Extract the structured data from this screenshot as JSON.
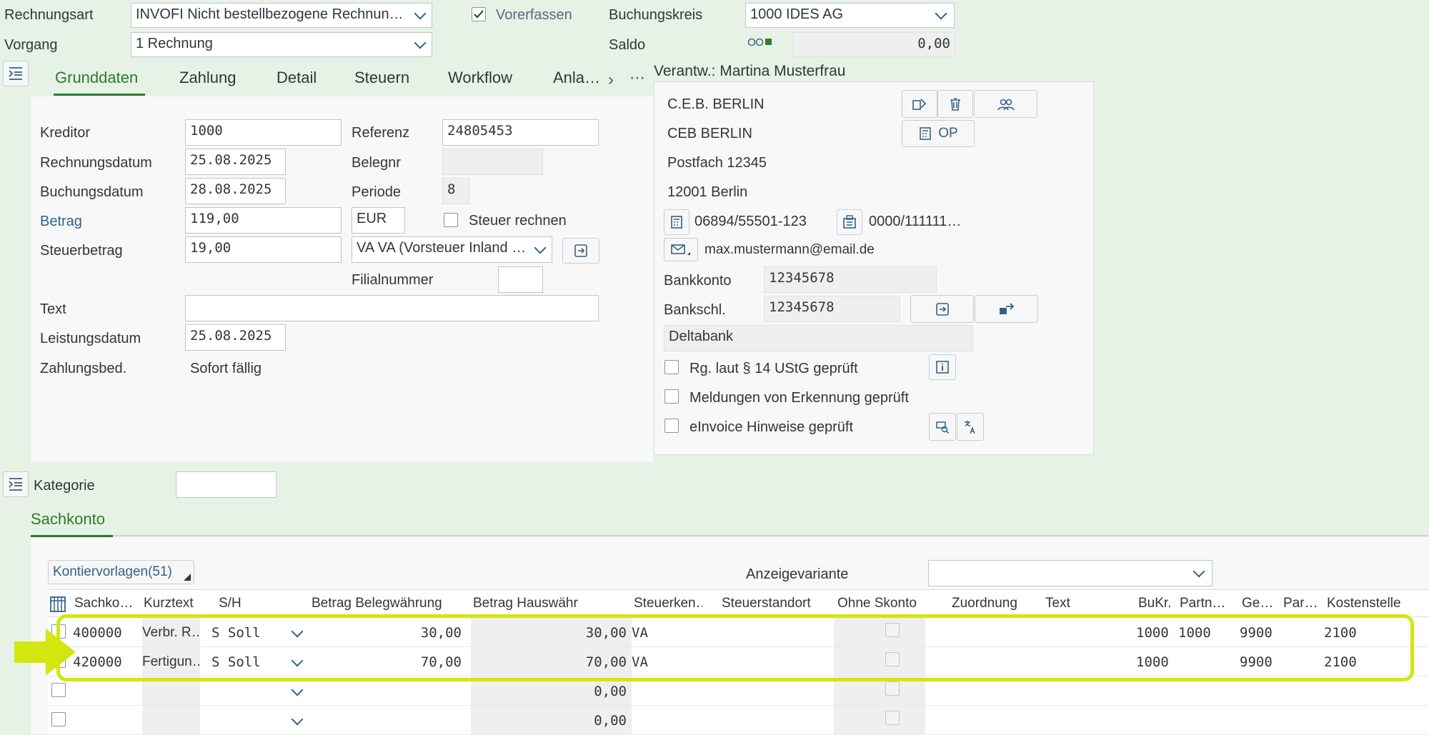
{
  "header": {
    "rechnungsart_label": "Rechnungsart",
    "rechnungsart_value": "INVOFI Nicht bestellbezogene Rechnun…",
    "vorgang_label": "Vorgang",
    "vorgang_value": "1 Rechnung",
    "vorerfassen_label": "Vorerfassen",
    "vorerfassen_checked": true,
    "buchungskreis_label": "Buchungskreis",
    "buchungskreis_value": "1000 IDES AG",
    "saldo_label": "Saldo",
    "saldo_value": "0,00",
    "saldo_icon": "balance-status-icon"
  },
  "tabs": [
    "Grunddaten",
    "Zahlung",
    "Detail",
    "Steuern",
    "Workflow",
    "Anla…"
  ],
  "active_tab": "Grunddaten",
  "grunddaten": {
    "kreditor_label": "Kreditor",
    "kreditor_value": "1000",
    "referenz_label": "Referenz",
    "referenz_value": "24805453",
    "rechnungsdatum_label": "Rechnungsdatum",
    "rechnungsdatum_value": "25.08.2025",
    "belegnr_label": "Belegnr",
    "belegnr_value": "",
    "buchungsdatum_label": "Buchungsdatum",
    "buchungsdatum_value": "28.08.2025",
    "periode_label": "Periode",
    "periode_value": "8",
    "betrag_label": "Betrag",
    "betrag_value": "119,00",
    "waehrung_value": "EUR",
    "steuer_rechnen_label": "Steuer rechnen",
    "steuerbetrag_label": "Steuerbetrag",
    "steuerbetrag_value": "19,00",
    "steuerkennz_value": "VA VA (Vorsteuer Inland …",
    "filialnummer_label": "Filialnummer",
    "filialnummer_value": "",
    "text_label": "Text",
    "text_value": "",
    "leistungsdatum_label": "Leistungsdatum",
    "leistungsdatum_value": "25.08.2025",
    "zahlungsbed_label": "Zahlungsbed.",
    "zahlungsbed_value": "Sofort fällig"
  },
  "vendor": {
    "title": "Verantw.: Martina Musterfrau",
    "line1": "C.E.B. BERLIN",
    "line2": "CEB BERLIN",
    "line3": "Postfach 12345",
    "line4": "12001 Berlin",
    "phone": "06894/55501-123",
    "fax": "0000/111111…",
    "email": "max.mustermann@email.de",
    "op_label": "OP",
    "bankkonto_label": "Bankkonto",
    "bankkonto_value": "12345678",
    "bankschl_label": "Bankschl.",
    "bankschl_value": "12345678",
    "bank_name": "Deltabank",
    "check1_label": "Rg. laut § 14 UStG geprüft",
    "check2_label": "Meldungen von Erkennung geprüft",
    "check3_label": "eInvoice Hinweise geprüft"
  },
  "kategorie": {
    "label": "Kategorie",
    "value": ""
  },
  "sachkonto": {
    "tab_label": "Sachkonto",
    "kontiervorlagen_label": "Kontiervorlagen(51)",
    "anzeigevariante_label": "Anzeigevariante",
    "anzeigevariante_value": "",
    "columns": [
      "Sachko…",
      "Kurztext",
      "S/H",
      "Betrag Belegwährung",
      "Betrag Hauswähr",
      "Steuerken…",
      "Steuerstandort",
      "Ohne Skonto",
      "Zuordnung",
      "Text",
      "BuKr.",
      "Partn…",
      "Ge…",
      "Par…",
      "Kostenstelle"
    ],
    "rows": [
      {
        "sachkonto": "400000",
        "kurztext": "Verbr. R…",
        "sh": "S Soll",
        "betrag_beleg": "30,00",
        "betrag_haus": "30,00",
        "steuerkennz": "VA",
        "bukr": "1000",
        "partner": "1000",
        "geschaeftsbereich": "9900",
        "kostenstelle": "2100"
      },
      {
        "sachkonto": "420000",
        "kurztext": "Fertigun…",
        "sh": "S Soll",
        "betrag_beleg": "70,00",
        "betrag_haus": "70,00",
        "steuerkennz": "VA",
        "bukr": "1000",
        "partner": "",
        "geschaeftsbereich": "9900",
        "kostenstelle": "2100"
      },
      {
        "sachkonto": "",
        "kurztext": "",
        "sh": "",
        "betrag_beleg": "",
        "betrag_haus": "0,00",
        "steuerkennz": "",
        "bukr": "",
        "partner": "",
        "geschaeftsbereich": "",
        "kostenstelle": ""
      },
      {
        "sachkonto": "",
        "kurztext": "",
        "sh": "",
        "betrag_beleg": "",
        "betrag_haus": "0,00",
        "steuerkennz": "",
        "bukr": "",
        "partner": "",
        "geschaeftsbereich": "",
        "kostenstelle": ""
      }
    ]
  },
  "colors": {
    "background": "#e6f2e5",
    "highlight": "#d4e60f",
    "active_tab": "#2b7c2b",
    "link_blue": "#346187"
  }
}
